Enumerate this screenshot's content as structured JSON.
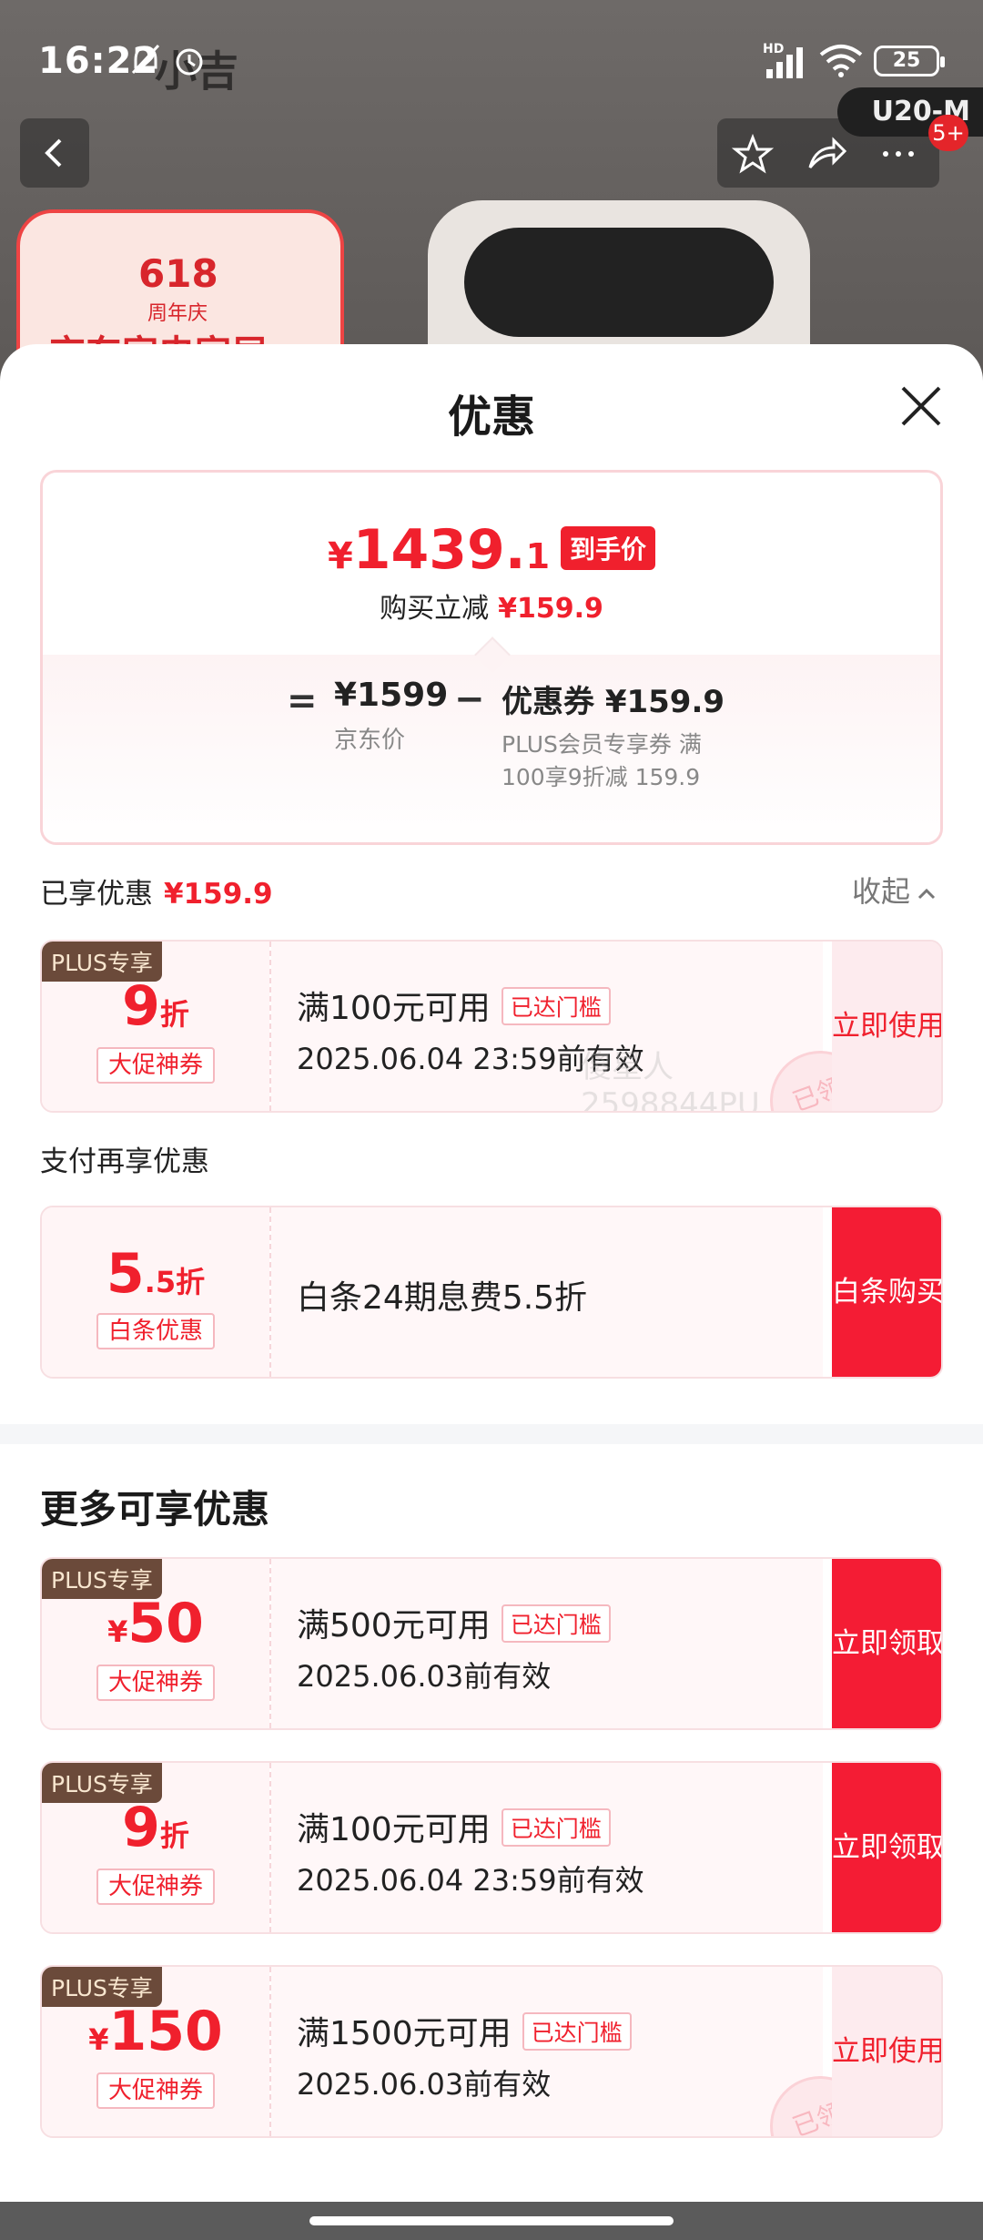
{
  "status_bar": {
    "time": "16:22",
    "battery": "25",
    "network": "HD"
  },
  "backdrop": {
    "brand_ghost": "小吉",
    "model_tag": "U20-M",
    "badge": "5+",
    "promo_number": "618",
    "promo_sub": "周年庆",
    "promo_title": "京东家电家居"
  },
  "sheet": {
    "title": "优惠",
    "summary": {
      "final_yen": "¥",
      "final_int": "1439.",
      "final_dec": "1",
      "final_tag": "到手价",
      "reduce_label": "购买立减",
      "reduce_value": "¥159.9",
      "eq": "=",
      "jd_price": "¥1599",
      "jd_label": "京东价",
      "minus": "−",
      "coupon_line": "优惠券 ¥159.9",
      "coupon_desc": "PLUS会员专享券 满100享9折减 159.9"
    },
    "enjoyed": {
      "label": "已享优惠",
      "value": "¥159.9",
      "collapse": "收起"
    },
    "pay_again_label": "支付再享优惠",
    "more_title": "更多可享优惠"
  },
  "coupons": {
    "enjoyed_plus": {
      "plus": "PLUS专享",
      "big": "9",
      "small": "折",
      "tag": "大促神券",
      "cond": "满100元可用",
      "cond_tag": "已达门槛",
      "valid": "2025.06.04 23:59前有效",
      "action": "立即使用",
      "stamp": "已领",
      "watermark": "傻星人2598844PU"
    },
    "baitiao": {
      "big": "5",
      "small": ".5折",
      "tag": "白条优惠",
      "desc": "白条24期息费5.5折",
      "action": "白条购买"
    },
    "more_1": {
      "plus": "PLUS专享",
      "yen": "¥",
      "big": "50",
      "tag": "大促神券",
      "cond": "满500元可用",
      "cond_tag": "已达门槛",
      "valid": "2025.06.03前有效",
      "action": "立即领取"
    },
    "more_2": {
      "plus": "PLUS专享",
      "big": "9",
      "small": "折",
      "tag": "大促神券",
      "cond": "满100元可用",
      "cond_tag": "已达门槛",
      "valid": "2025.06.04 23:59前有效",
      "action": "立即领取"
    },
    "more_3": {
      "plus": "PLUS专享",
      "yen": "¥",
      "big": "150",
      "tag": "大促神券",
      "cond": "满1500元可用",
      "cond_tag": "已达门槛",
      "valid": "2025.06.03前有效",
      "action": "立即使用",
      "stamp": "已领"
    }
  },
  "colors": {
    "accent": "#f0202d",
    "button_red": "#f41c34",
    "plus_brown": "#6b4a3a"
  }
}
